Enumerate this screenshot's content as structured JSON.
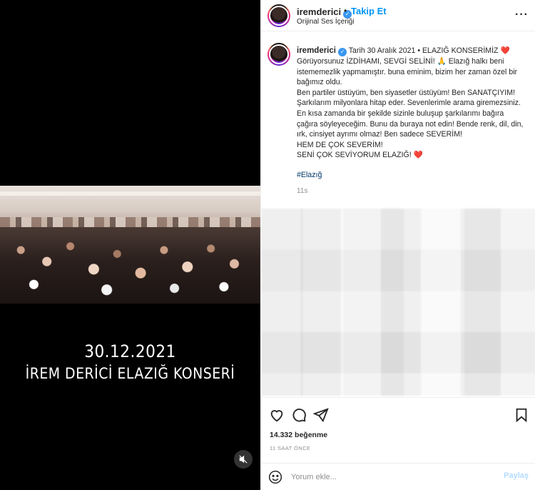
{
  "video": {
    "date": "30.12.2021",
    "title": "İREM DERİCİ ELAZIĞ KONSERİ",
    "mute_icon": "speaker-muted-icon"
  },
  "header": {
    "username": "iremderici",
    "verified_icon": "verified-badge-icon",
    "separator": "•",
    "follow_label": "Takip Et",
    "audio_label": "Orijinal Ses İçeriği",
    "more_icon": "more-options-icon"
  },
  "caption": {
    "username": "iremderici",
    "lines": [
      "Tarih 30 Aralık 2021 • ELAZIĞ KONSERİMİZ ❤️",
      "Görüyorsunuz İZDİHAMI, SEVGİ SELİNİ! 🙏 Elazığ halkı beni istememezlik yapmamıştır. buna eminim, bizim her zaman özel bir bağımız oldu.",
      "Ben partiler üstüyüm, ben siyasetler üstüyüm! Ben SANATÇIYIM! Şarkılarım milyonlara hitap eder. Sevenlerimle arama giremezsiniz. En kısa zamanda bir şekilde sizinle buluşup şarkılarımı bağıra çağıra söyleyeceğim. Bunu da buraya not edin! Bende renk, dil, din, ırk, cinsiyet ayrımı olmaz! Ben sadece SEVERİM!",
      "HEM DE ÇOK SEVERİM!",
      "SENİ ÇOK SEVİYORUM ELAZIĞ! ❤️"
    ],
    "hashtag": "#Elazığ",
    "time_ago": "11s"
  },
  "actions": {
    "like_icon": "heart-icon",
    "comment_icon": "comment-icon",
    "share_icon": "share-icon",
    "save_icon": "bookmark-icon"
  },
  "likes_text": "14.332 beğenme",
  "posted_ago": "11 SAAT ÖNCE",
  "comment": {
    "emoji_icon": "emoji-icon",
    "placeholder": "Yorum ekle...",
    "post_label": "Paylaş"
  },
  "colors": {
    "accent": "#0095f6",
    "verified": "#3897f0",
    "heart": "#e0245e"
  }
}
